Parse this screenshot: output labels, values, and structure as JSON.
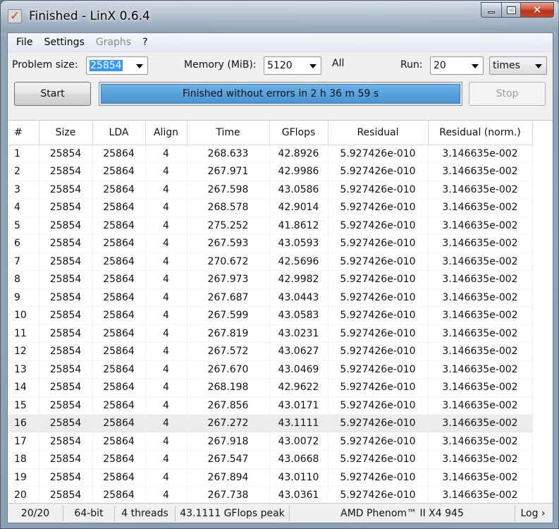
{
  "window": {
    "title": "Finished - LinX 0.6.4",
    "app_icon_glyph": "✓",
    "close_glyph": "✕"
  },
  "menu": [
    "File",
    "Settings",
    "Graphs",
    "?"
  ],
  "controls": {
    "problem_size_label": "Problem size:",
    "problem_size_value": "25854",
    "memory_label": "Memory (MiB):",
    "memory_value": "5120",
    "all_label": "All",
    "run_label": "Run:",
    "run_value": "20",
    "run_unit": "times"
  },
  "actions": {
    "start_label": "Start",
    "stop_label": "Stop",
    "progress_text": "Finished without errors in 2 h 36 m 59 s",
    "progress_fraction": 1.0,
    "progress_color": "#58a2dd"
  },
  "table": {
    "columns": [
      "#",
      "Size",
      "LDA",
      "Align",
      "Time",
      "GFlops",
      "Residual",
      "Residual (norm.)"
    ],
    "rows": [
      [
        "1",
        "25854",
        "25864",
        "4",
        "268.633",
        "42.8926",
        "5.927426e-010",
        "3.146635e-002"
      ],
      [
        "2",
        "25854",
        "25864",
        "4",
        "267.971",
        "42.9986",
        "5.927426e-010",
        "3.146635e-002"
      ],
      [
        "3",
        "25854",
        "25864",
        "4",
        "267.598",
        "43.0586",
        "5.927426e-010",
        "3.146635e-002"
      ],
      [
        "4",
        "25854",
        "25864",
        "4",
        "268.578",
        "42.9014",
        "5.927426e-010",
        "3.146635e-002"
      ],
      [
        "5",
        "25854",
        "25864",
        "4",
        "275.252",
        "41.8612",
        "5.927426e-010",
        "3.146635e-002"
      ],
      [
        "6",
        "25854",
        "25864",
        "4",
        "267.593",
        "43.0593",
        "5.927426e-010",
        "3.146635e-002"
      ],
      [
        "7",
        "25854",
        "25864",
        "4",
        "270.672",
        "42.5696",
        "5.927426e-010",
        "3.146635e-002"
      ],
      [
        "8",
        "25854",
        "25864",
        "4",
        "267.973",
        "42.9982",
        "5.927426e-010",
        "3.146635e-002"
      ],
      [
        "9",
        "25854",
        "25864",
        "4",
        "267.687",
        "43.0443",
        "5.927426e-010",
        "3.146635e-002"
      ],
      [
        "10",
        "25854",
        "25864",
        "4",
        "267.599",
        "43.0583",
        "5.927426e-010",
        "3.146635e-002"
      ],
      [
        "11",
        "25854",
        "25864",
        "4",
        "267.819",
        "43.0231",
        "5.927426e-010",
        "3.146635e-002"
      ],
      [
        "12",
        "25854",
        "25864",
        "4",
        "267.572",
        "43.0627",
        "5.927426e-010",
        "3.146635e-002"
      ],
      [
        "13",
        "25854",
        "25864",
        "4",
        "267.670",
        "43.0469",
        "5.927426e-010",
        "3.146635e-002"
      ],
      [
        "14",
        "25854",
        "25864",
        "4",
        "268.198",
        "42.9622",
        "5.927426e-010",
        "3.146635e-002"
      ],
      [
        "15",
        "25854",
        "25864",
        "4",
        "267.856",
        "43.0171",
        "5.927426e-010",
        "3.146635e-002"
      ],
      [
        "16",
        "25854",
        "25864",
        "4",
        "267.272",
        "43.1111",
        "5.927426e-010",
        "3.146635e-002"
      ],
      [
        "17",
        "25854",
        "25864",
        "4",
        "267.918",
        "43.0072",
        "5.927426e-010",
        "3.146635e-002"
      ],
      [
        "18",
        "25854",
        "25864",
        "4",
        "267.547",
        "43.0668",
        "5.927426e-010",
        "3.146635e-002"
      ],
      [
        "19",
        "25854",
        "25864",
        "4",
        "267.894",
        "43.0110",
        "5.927426e-010",
        "3.146635e-002"
      ],
      [
        "20",
        "25854",
        "25864",
        "4",
        "267.738",
        "43.0361",
        "5.927426e-010",
        "3.146635e-002"
      ]
    ],
    "highlighted_row": 16
  },
  "status": {
    "runs": "20/20",
    "arch": "64-bit",
    "threads": "4 threads",
    "peak": "43.1111 GFlops peak",
    "cpu": "AMD Phenom™ II X4 945",
    "log": "Log ›"
  }
}
